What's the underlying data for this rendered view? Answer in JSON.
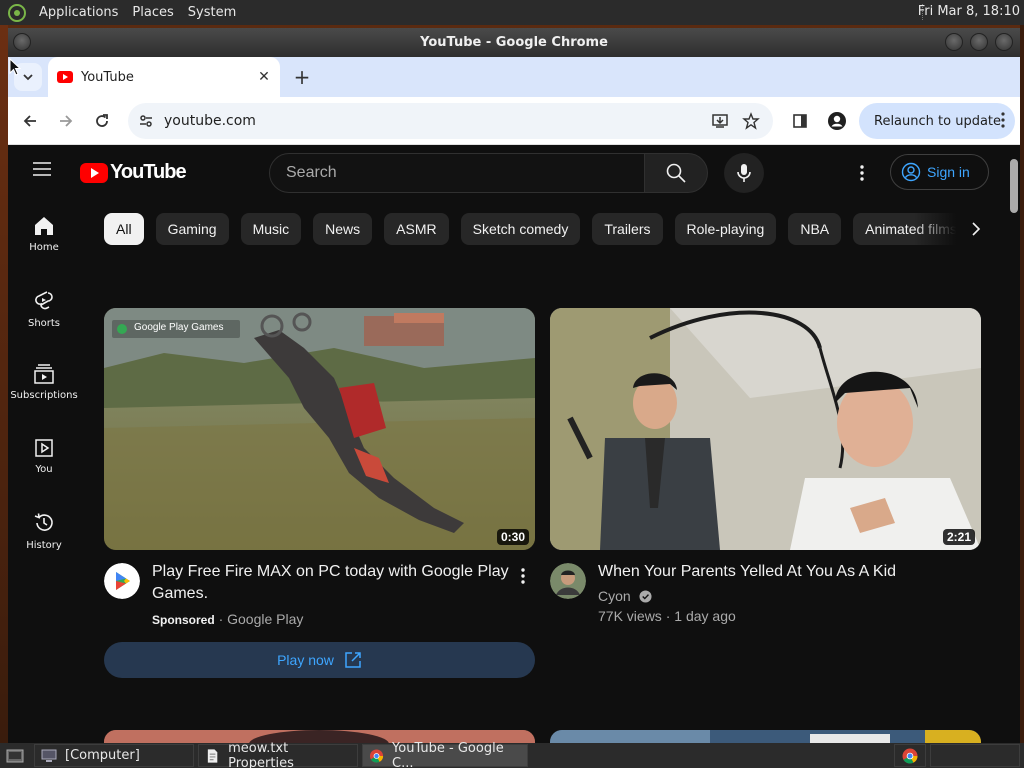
{
  "desktop": {
    "menus": [
      "Applications",
      "Places",
      "System"
    ],
    "clock": "Fri Mar  8, 18:10"
  },
  "window": {
    "title": "YouTube - Google Chrome"
  },
  "browser": {
    "tab_title": "YouTube",
    "url": "youtube.com",
    "relaunch_label": "Relaunch to update"
  },
  "youtube": {
    "search_placeholder": "Search",
    "signin_label": "Sign in",
    "sidebar": [
      {
        "label": "Home"
      },
      {
        "label": "Shorts"
      },
      {
        "label": "Subscriptions"
      },
      {
        "label": "You"
      },
      {
        "label": "History"
      }
    ],
    "chips": [
      "All",
      "Gaming",
      "Music",
      "News",
      "ASMR",
      "Sketch comedy",
      "Trailers",
      "Role-playing",
      "NBA",
      "Animated films"
    ],
    "videos": [
      {
        "title": "Play Free Fire MAX on PC today with Google Play Games.",
        "sponsored": "Sponsored",
        "channel": "Google Play",
        "duration": "0:30",
        "thumb_badge": "Google Play Games",
        "cta": "Play now"
      },
      {
        "title": "When Your Parents Yelled At You As A Kid",
        "channel": "Cyon",
        "views": "77K views",
        "age": "1 day ago",
        "duration": "2:21"
      }
    ]
  },
  "taskbar": {
    "items": [
      "[Computer]",
      "meow.txt Properties",
      "YouTube - Google C..."
    ]
  },
  "colors": {
    "yt_bg": "#0f0f0f",
    "yt_red": "#ff0000",
    "link_blue": "#3ea6ff",
    "chrome_tabstrip": "#d9e5fb"
  }
}
